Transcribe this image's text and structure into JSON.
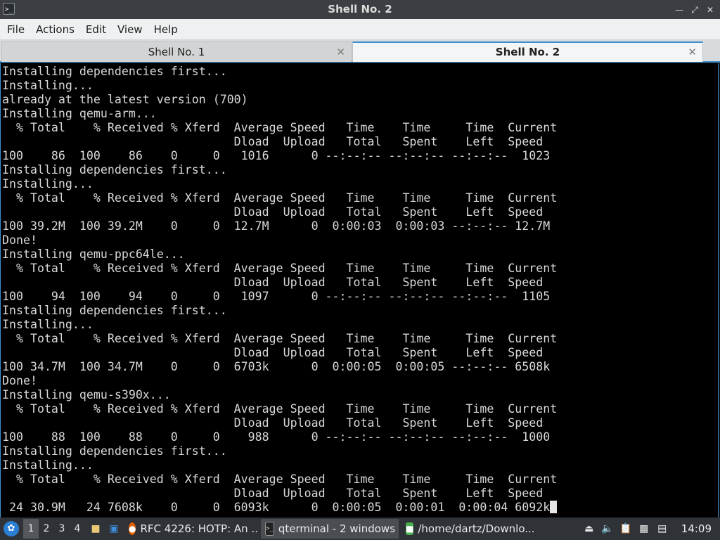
{
  "window": {
    "title": "Shell No. 2",
    "app_icon": "terminal-icon",
    "controls": [
      "minimize-icon",
      "maximize-icon",
      "close-icon"
    ]
  },
  "menubar": {
    "items": [
      "File",
      "Actions",
      "Edit",
      "View",
      "Help"
    ]
  },
  "tabs": [
    {
      "label": "Shell No. 1",
      "active": false
    },
    {
      "label": "Shell No. 2",
      "active": true
    }
  ],
  "terminal": {
    "lines": [
      "Installing dependencies first...",
      "Installing...",
      "already at the latest version (700)",
      "Installing qemu-arm...",
      "  % Total    % Received % Xferd  Average Speed   Time    Time     Time  Current",
      "                                 Dload  Upload   Total   Spent    Left  Speed",
      "100    86  100    86    0     0   1016      0 --:--:-- --:--:-- --:--:--  1023",
      "Installing dependencies first...",
      "Installing...",
      "  % Total    % Received % Xferd  Average Speed   Time    Time     Time  Current",
      "                                 Dload  Upload   Total   Spent    Left  Speed",
      "100 39.2M  100 39.2M    0     0  12.7M      0  0:00:03  0:00:03 --:--:-- 12.7M",
      "Done!",
      "Installing qemu-ppc64le...",
      "  % Total    % Received % Xferd  Average Speed   Time    Time     Time  Current",
      "                                 Dload  Upload   Total   Spent    Left  Speed",
      "100    94  100    94    0     0   1097      0 --:--:-- --:--:-- --:--:--  1105",
      "Installing dependencies first...",
      "Installing...",
      "  % Total    % Received % Xferd  Average Speed   Time    Time     Time  Current",
      "                                 Dload  Upload   Total   Spent    Left  Speed",
      "100 34.7M  100 34.7M    0     0  6703k      0  0:00:05  0:00:05 --:--:-- 6508k",
      "Done!",
      "Installing qemu-s390x...",
      "  % Total    % Received % Xferd  Average Speed   Time    Time     Time  Current",
      "                                 Dload  Upload   Total   Spent    Left  Speed",
      "100    88  100    88    0     0    988      0 --:--:-- --:--:-- --:--:--  1000",
      "Installing dependencies first...",
      "Installing...",
      "  % Total    % Received % Xferd  Average Speed   Time    Time     Time  Current",
      "                                 Dload  Upload   Total   Spent    Left  Speed",
      " 24 30.9M   24 7608k    0     0  6093k      0  0:00:05  0:00:01  0:00:04 6092k"
    ]
  },
  "taskbar": {
    "start_icon": "app-menu-icon",
    "desktops": [
      "1",
      "2",
      "3",
      "4"
    ],
    "active_desktop": "1",
    "quicklaunch": [
      "file-manager-icon",
      "show-desktop-icon"
    ],
    "tasks": [
      {
        "label": "RFC 4226: HOTP: An ...",
        "icon": "firefox-icon",
        "active": false
      },
      {
        "label": "qterminal - 2 windows",
        "icon": "terminal-icon",
        "active": true
      },
      {
        "label": "/home/dartz/Downlo...",
        "icon": "folder-icon",
        "active": false
      }
    ],
    "tray": [
      "eject-icon",
      "volume-icon",
      "clipboard-icon",
      "display-icon",
      "network-icon"
    ],
    "clock": "14:09"
  }
}
